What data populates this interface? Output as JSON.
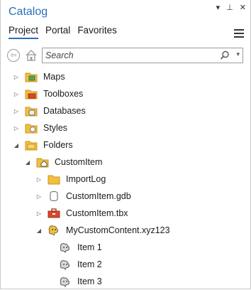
{
  "pane": {
    "title": "Catalog",
    "controls": [
      "▾",
      "⊥",
      "✕"
    ]
  },
  "tabs": [
    {
      "label": "Project",
      "active": true
    },
    {
      "label": "Portal",
      "active": false
    },
    {
      "label": "Favorites",
      "active": false
    }
  ],
  "search": {
    "placeholder": "Search"
  },
  "tree": [
    {
      "label": "Maps",
      "expanded": false,
      "icon": "maps-folder-icon"
    },
    {
      "label": "Toolboxes",
      "expanded": false,
      "icon": "toolboxes-folder-icon"
    },
    {
      "label": "Databases",
      "expanded": false,
      "icon": "databases-folder-icon"
    },
    {
      "label": "Styles",
      "expanded": false,
      "icon": "styles-folder-icon"
    },
    {
      "label": "Folders",
      "expanded": true,
      "icon": "folders-icon"
    },
    {
      "label": "CustomItem",
      "expanded": true,
      "icon": "home-folder-icon"
    },
    {
      "label": "ImportLog",
      "expanded": false,
      "icon": "folder-icon"
    },
    {
      "label": "CustomItem.gdb",
      "expanded": false,
      "icon": "geodatabase-icon"
    },
    {
      "label": "CustomItem.tbx",
      "expanded": false,
      "icon": "toolbox-icon"
    },
    {
      "label": "MyCustomContent.xyz123",
      "expanded": true,
      "icon": "custom-content-icon"
    },
    {
      "label": "Item 1",
      "icon": "custom-item-icon"
    },
    {
      "label": "Item 2",
      "icon": "custom-item-icon"
    },
    {
      "label": "Item 3",
      "icon": "custom-item-icon"
    }
  ],
  "colors": {
    "accent": "#2a6fb8",
    "folder": "#f0c040"
  }
}
